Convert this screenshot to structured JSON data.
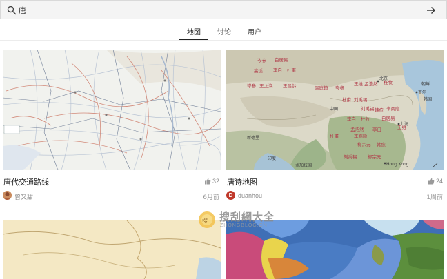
{
  "search": {
    "query": "唐",
    "placeholder": ""
  },
  "tabs": [
    {
      "label": "地图",
      "active": true
    },
    {
      "label": "讨论",
      "active": false
    },
    {
      "label": "用户",
      "active": false
    }
  ],
  "results": [
    {
      "title": "唐代交通路线",
      "likes": "32",
      "author": "曾又甜",
      "date": "6月前"
    },
    {
      "title": "唐诗地图",
      "likes": "24",
      "author": "duanhou",
      "avatar_letter": "D",
      "date": "1周前"
    }
  ],
  "map_labels": {
    "left": [],
    "right": [
      "北京",
      "中国",
      "印度",
      "嘎尔",
      "盂加拉国",
      "Hong Kong",
      "朝鲜",
      "韩国",
      "首尔",
      "上海",
      "杜甫",
      "李白",
      "白居易",
      "王之涣",
      "王昌龄",
      "孟浩然",
      "杜牧",
      "岑参",
      "王维",
      "高适",
      "刘禹锡",
      "韩愈",
      "李商隐",
      "柳宗元"
    ]
  },
  "watermark": {
    "text": "搜刮網大全",
    "sub": "ZHONGBLOG.CN"
  },
  "colors": {
    "accent": "#222222",
    "like_icon": "#9a9a9a",
    "avatar_red": "#c0392b"
  }
}
